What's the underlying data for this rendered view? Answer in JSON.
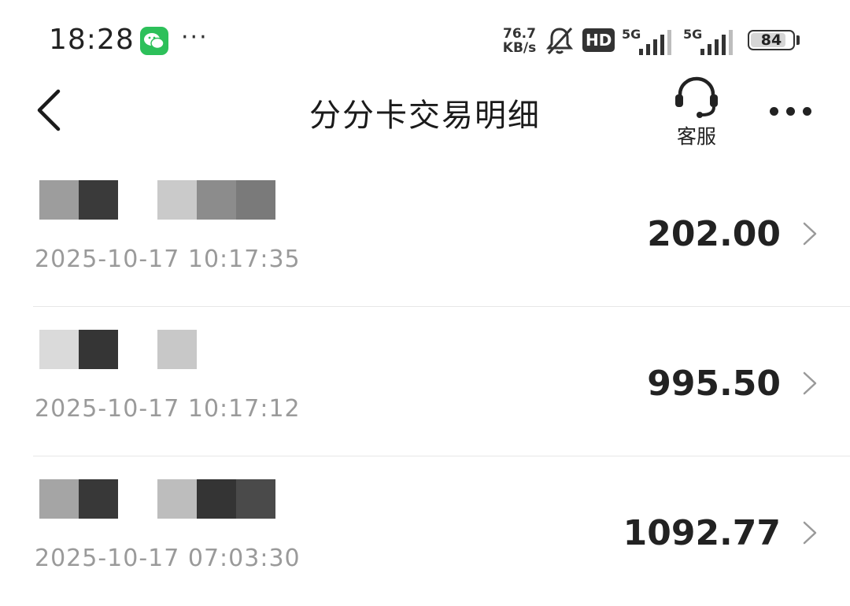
{
  "status_bar": {
    "time": "18:28",
    "app_icon": "wechat-icon",
    "more_indicator": "···",
    "net_speed_value": "76.7",
    "net_speed_unit": "KB/s",
    "hd_badge": "HD",
    "sim1_label": "5G",
    "sim2_label": "5G",
    "battery_level": "84",
    "battery_fraction": 0.84
  },
  "nav": {
    "title": "分分卡交易明细",
    "service_label": "客服",
    "back_icon": "chevron-left-icon",
    "service_icon": "headset-icon",
    "more_icon": "more-dots-icon"
  },
  "transactions": [
    {
      "merchant": "",
      "datetime": "2025-10-17 10:17:35",
      "amount": "202.00"
    },
    {
      "merchant": "",
      "datetime": "2025-10-17 10:17:12",
      "amount": "995.50"
    },
    {
      "merchant": "",
      "datetime": "2025-10-17 07:03:30",
      "amount": "1092.77"
    }
  ],
  "colors": {
    "text_primary": "#222222",
    "text_secondary": "#9a9a9a",
    "divider": "#e7e7e7",
    "wechat_green": "#2dc05a"
  }
}
